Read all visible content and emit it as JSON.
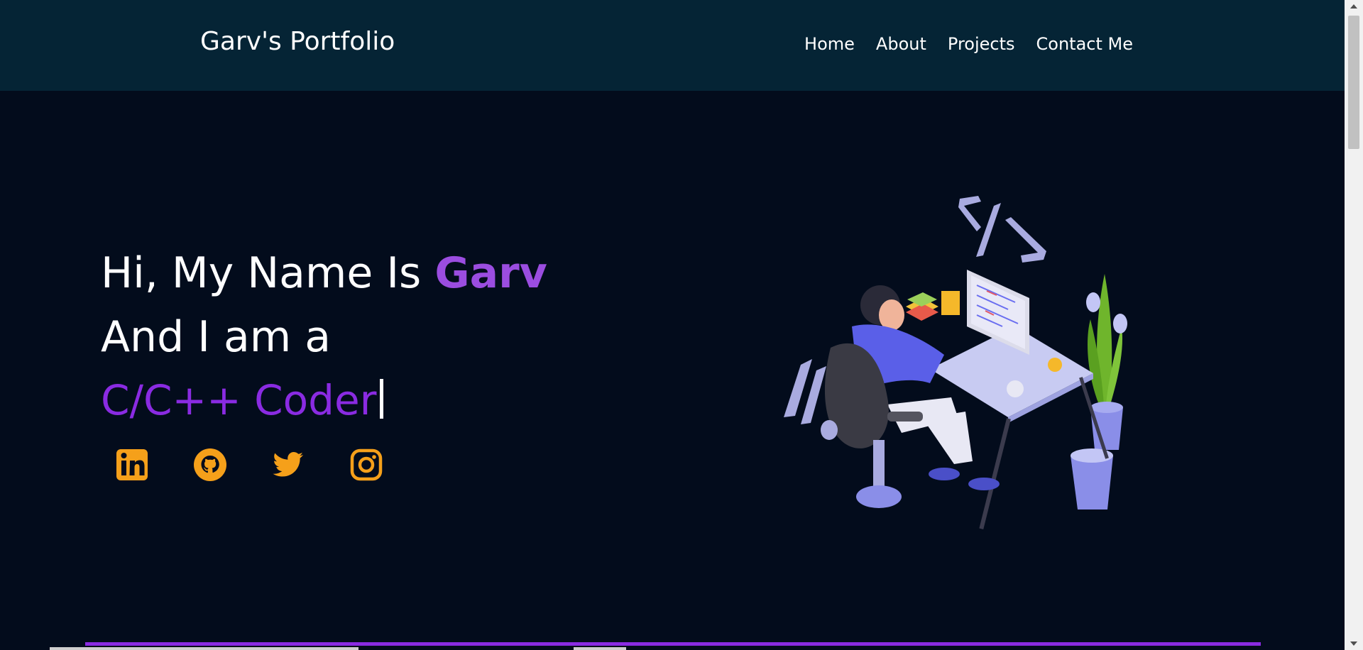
{
  "navbar": {
    "brand": "Garv's Portfolio",
    "links": [
      "Home",
      "About",
      "Projects",
      "Contact Me"
    ]
  },
  "hero": {
    "line1_prefix": "Hi, My Name Is ",
    "name": "Garv",
    "line2": "And I am a",
    "typed_role": "C/C++ Coder"
  },
  "socials": [
    {
      "icon": "linkedin-icon"
    },
    {
      "icon": "github-icon"
    },
    {
      "icon": "twitter-icon"
    },
    {
      "icon": "instagram-icon"
    }
  ],
  "colors": {
    "navbar_bg": "#052435",
    "page_bg": "#030c1c",
    "accent_purple": "#8a2be2",
    "name_purple": "#9b4de0",
    "social_orange": "#f5a01a"
  }
}
